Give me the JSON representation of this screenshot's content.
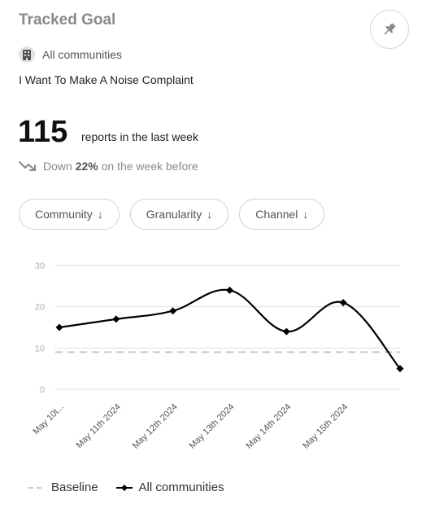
{
  "header": {
    "title": "Tracked Goal"
  },
  "community": {
    "label": "All communities"
  },
  "goal": {
    "name": "I Want To Make A Noise Complaint"
  },
  "stats": {
    "count": "115",
    "reports_text": "reports in the last week",
    "trend_prefix": "Down",
    "trend_percent": "22%",
    "trend_suffix": "on the week before"
  },
  "filters": [
    {
      "label": "Community"
    },
    {
      "label": "Granularity"
    },
    {
      "label": "Channel"
    }
  ],
  "colors": {
    "series": "#000000",
    "baseline": "#c8c8c8",
    "grid": "#e0e0e0",
    "axis_text": "#b0b0b0"
  },
  "chart_data": {
    "type": "line",
    "categories": [
      "May 10t...",
      "May 11th 2024",
      "May 12th 2024",
      "May 13th 2024",
      "May 14th 2024",
      "May 15th 2024",
      ""
    ],
    "series": [
      {
        "name": "All communities",
        "values": [
          15,
          17,
          19,
          24,
          14,
          21,
          5
        ]
      },
      {
        "name": "Baseline",
        "values": [
          9,
          9,
          9,
          9,
          9,
          9,
          9
        ]
      }
    ],
    "yticks": [
      0,
      10,
      20,
      30
    ],
    "ylim": [
      0,
      30
    ],
    "grid": true,
    "legend": "bottom-left"
  },
  "legend": {
    "baseline_label": "Baseline",
    "series_label": "All communities"
  }
}
